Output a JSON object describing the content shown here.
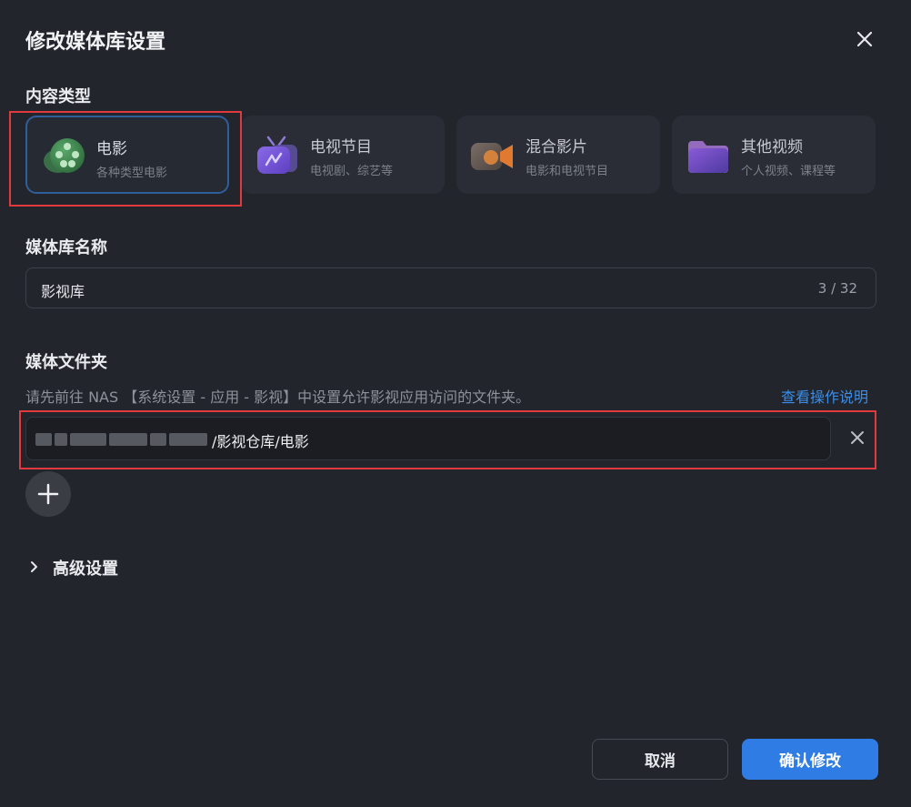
{
  "dialog": {
    "title": "修改媒体库设置"
  },
  "content_type": {
    "label": "内容类型",
    "options": [
      {
        "name": "电影",
        "desc": "各种类型电影",
        "icon": "film-reel-icon",
        "selected": true
      },
      {
        "name": "电视节目",
        "desc": "电视剧、综艺等",
        "icon": "tv-icon",
        "selected": false
      },
      {
        "name": "混合影片",
        "desc": "电影和电视节目",
        "icon": "video-camera-icon",
        "selected": false
      },
      {
        "name": "其他视频",
        "desc": "个人视频、课程等",
        "icon": "folder-icon",
        "selected": false
      }
    ]
  },
  "library_name": {
    "label": "媒体库名称",
    "value": "影视库",
    "counter": "3 / 32"
  },
  "media_folder": {
    "label": "媒体文件夹",
    "hint": "请先前往 NAS 【系统设置 - 应用 - 影视】中设置允许影视应用访问的文件夹。",
    "help_link": "查看操作说明",
    "folders": [
      {
        "path_suffix": "/影视仓库/电影"
      }
    ]
  },
  "advanced": {
    "label": "高级设置"
  },
  "footer": {
    "cancel_label": "取消",
    "confirm_label": "确认修改"
  },
  "colors": {
    "accent": "#2f7ce5",
    "link": "#3b8eea",
    "highlight": "#e0393e",
    "background": "#22252c"
  }
}
